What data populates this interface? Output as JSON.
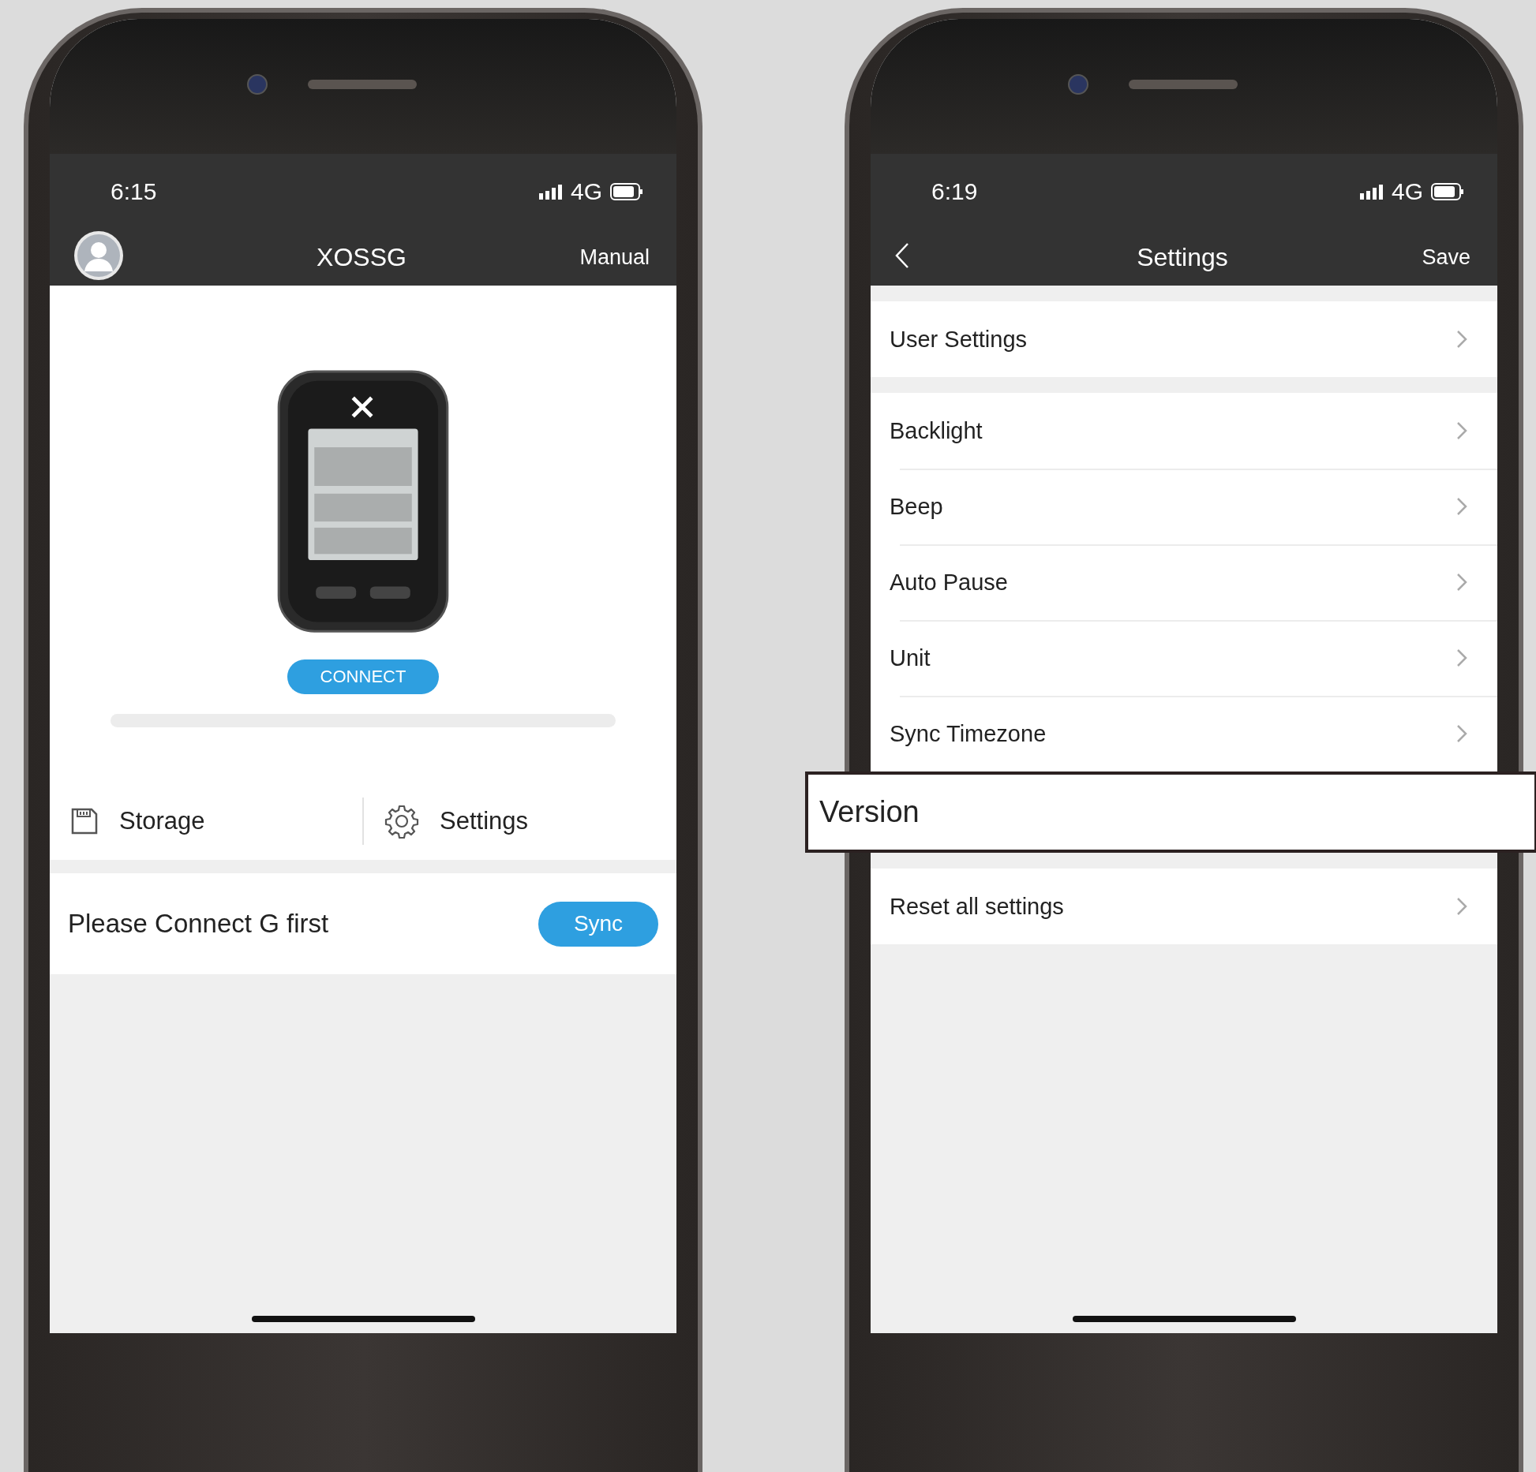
{
  "phones": [
    {
      "kind": "home",
      "status": {
        "time": "6:15",
        "network": "4G"
      },
      "header": {
        "title": "XOSSG",
        "action": "Manual"
      },
      "connect_button": "CONNECT",
      "tiles": [
        {
          "kind": "storage",
          "label": "Storage"
        },
        {
          "kind": "settings",
          "label": "Settings"
        }
      ],
      "message": "Please Connect G first",
      "sync_button": "Sync"
    },
    {
      "kind": "settings",
      "status": {
        "time": "6:19",
        "network": "4G"
      },
      "header": {
        "title": "Settings",
        "action": "Save"
      },
      "groups": [
        [
          {
            "kind": "row",
            "label": "User Settings"
          }
        ],
        [
          {
            "kind": "row",
            "label": "Backlight"
          },
          {
            "kind": "row",
            "label": "Beep"
          },
          {
            "kind": "row",
            "label": "Auto Pause"
          },
          {
            "kind": "row",
            "label": "Unit"
          },
          {
            "kind": "row",
            "label": "Sync Timezone"
          },
          {
            "kind": "callout",
            "label": "Version"
          }
        ],
        [
          {
            "kind": "row",
            "label": "Reset all settings"
          }
        ]
      ]
    }
  ]
}
